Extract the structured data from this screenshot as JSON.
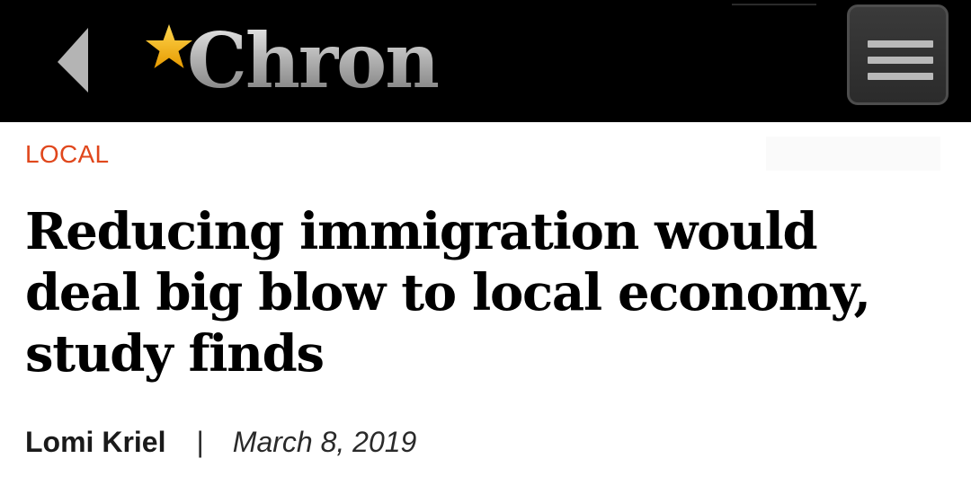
{
  "header": {
    "back_icon": "chevron-left-icon",
    "logo": {
      "star_icon": "gold-star-icon",
      "star_color": "#f5b40c",
      "text": "Chron"
    },
    "menu_icon": "hamburger-menu-icon",
    "background_color": "#000000"
  },
  "article": {
    "section": "LOCAL",
    "section_color": "#e0471c",
    "headline": "Reducing immigration would deal big blow to local economy, study finds",
    "author": "Lomi Kriel",
    "separator": "|",
    "date": "March 8, 2019"
  }
}
